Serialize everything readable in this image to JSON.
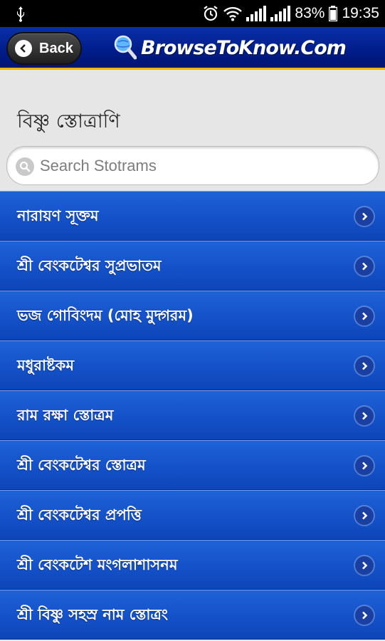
{
  "status_bar": {
    "battery_percent": "83%",
    "time": "19:35",
    "icons": [
      "usb-icon",
      "alarm-icon",
      "wifi-icon",
      "signal-icon",
      "signal-icon",
      "battery-icon"
    ]
  },
  "header": {
    "back_label": "Back",
    "logo_text": "BrowseToKnow.Com",
    "colors": {
      "bar": "#001c8a",
      "accent_line": "#f0b400"
    }
  },
  "page": {
    "title": "বিষ্ণু স্তোত্রাণি"
  },
  "search": {
    "placeholder": "Search Stotrams",
    "value": ""
  },
  "list": {
    "items": [
      {
        "label": "নারায়ণ সূক্তম"
      },
      {
        "label": "শ্রী বেংকটেশ্বর সুপ্রভাতম"
      },
      {
        "label": "ভজ গোবিংদম (মোহ মুদ্গরম)"
      },
      {
        "label": "মধুরাষ্টকম"
      },
      {
        "label": "রাম রক্ষা স্তোত্রম"
      },
      {
        "label": "শ্রী বেংকটেশ্বর স্তোত্রম"
      },
      {
        "label": "শ্রী বেংকটেশ্বর প্রপত্তি"
      },
      {
        "label": "শ্রী বেংকটেশ মংগলাশাসনম"
      },
      {
        "label": "শ্রী বিষ্ণু সহস্র নাম স্তোত্রং"
      }
    ],
    "colors": {
      "item": "#1451c8"
    }
  }
}
